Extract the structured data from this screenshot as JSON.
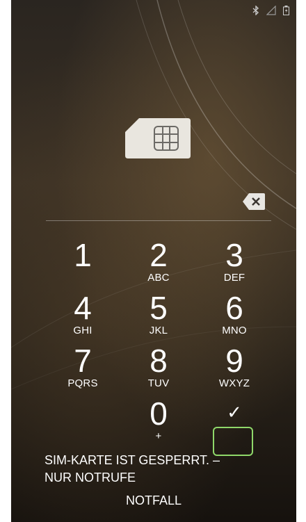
{
  "status_bar": {
    "icons": [
      "bluetooth-icon",
      "signal-icon",
      "battery-icon"
    ]
  },
  "sim_card": {
    "icon": "sim-card-icon"
  },
  "pin_entry": {
    "backspace_icon": "backspace-icon"
  },
  "keypad": {
    "keys": [
      {
        "digit": "1",
        "letters": ""
      },
      {
        "digit": "2",
        "letters": "ABC"
      },
      {
        "digit": "3",
        "letters": "DEF"
      },
      {
        "digit": "4",
        "letters": "GHI"
      },
      {
        "digit": "5",
        "letters": "JKL"
      },
      {
        "digit": "6",
        "letters": "MNO"
      },
      {
        "digit": "7",
        "letters": "PQRS"
      },
      {
        "digit": "8",
        "letters": "TUV"
      },
      {
        "digit": "9",
        "letters": "WXYZ"
      },
      {
        "digit": "0",
        "letters": "+"
      }
    ],
    "confirm_symbol": "✓"
  },
  "message": {
    "line1": "SIM-KARTE IST GESPERRT. –",
    "line2": "NUR NOTRUFE"
  },
  "emergency": {
    "label": "NOTFALL"
  }
}
